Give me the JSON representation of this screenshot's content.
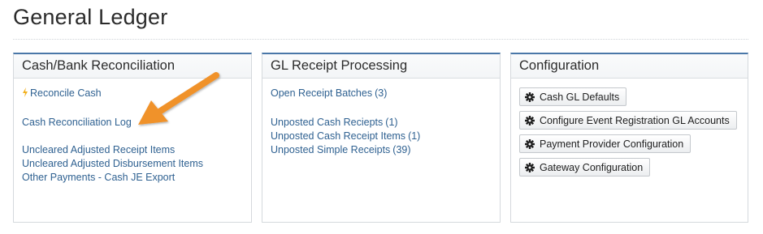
{
  "page": {
    "title": "General Ledger"
  },
  "panels": {
    "cash_bank": {
      "title": "Cash/Bank Reconciliation",
      "links": {
        "reconcile_cash": "Reconcile Cash",
        "cash_reconciliation_log": "Cash Reconciliation Log",
        "uncleared_receipt_items": "Uncleared Adjusted Receipt Items",
        "uncleared_disbursement_items": "Uncleared Adjusted Disbursement Items",
        "other_payments_export": "Other Payments - Cash JE Export"
      },
      "icons": {
        "reconcile_cash": "lightning-bolt-icon"
      }
    },
    "gl_receipt": {
      "title": "GL Receipt Processing",
      "links": [
        {
          "label": "Open Receipt Batches",
          "count": "(3)"
        },
        {
          "label": "Unposted Cash Reciepts",
          "count": "(1)"
        },
        {
          "label": "Unposted Cash Receipt Items",
          "count": "(1)"
        },
        {
          "label": "Unposted Simple Receipts",
          "count": "(39)"
        }
      ]
    },
    "configuration": {
      "title": "Configuration",
      "buttons": [
        {
          "label": "Cash GL Defaults",
          "icon": "gear-icon"
        },
        {
          "label": "Configure Event Registration GL Accounts",
          "icon": "gear-icon"
        },
        {
          "label": "Payment Provider Configuration",
          "icon": "gear-icon"
        },
        {
          "label": "Gateway Configuration",
          "icon": "gear-icon"
        }
      ]
    }
  },
  "colors": {
    "link": "#2f6191",
    "panel_top_border": "#4a77a8",
    "annotation_arrow": "#f0922b",
    "bolt": "#f2b01e"
  }
}
